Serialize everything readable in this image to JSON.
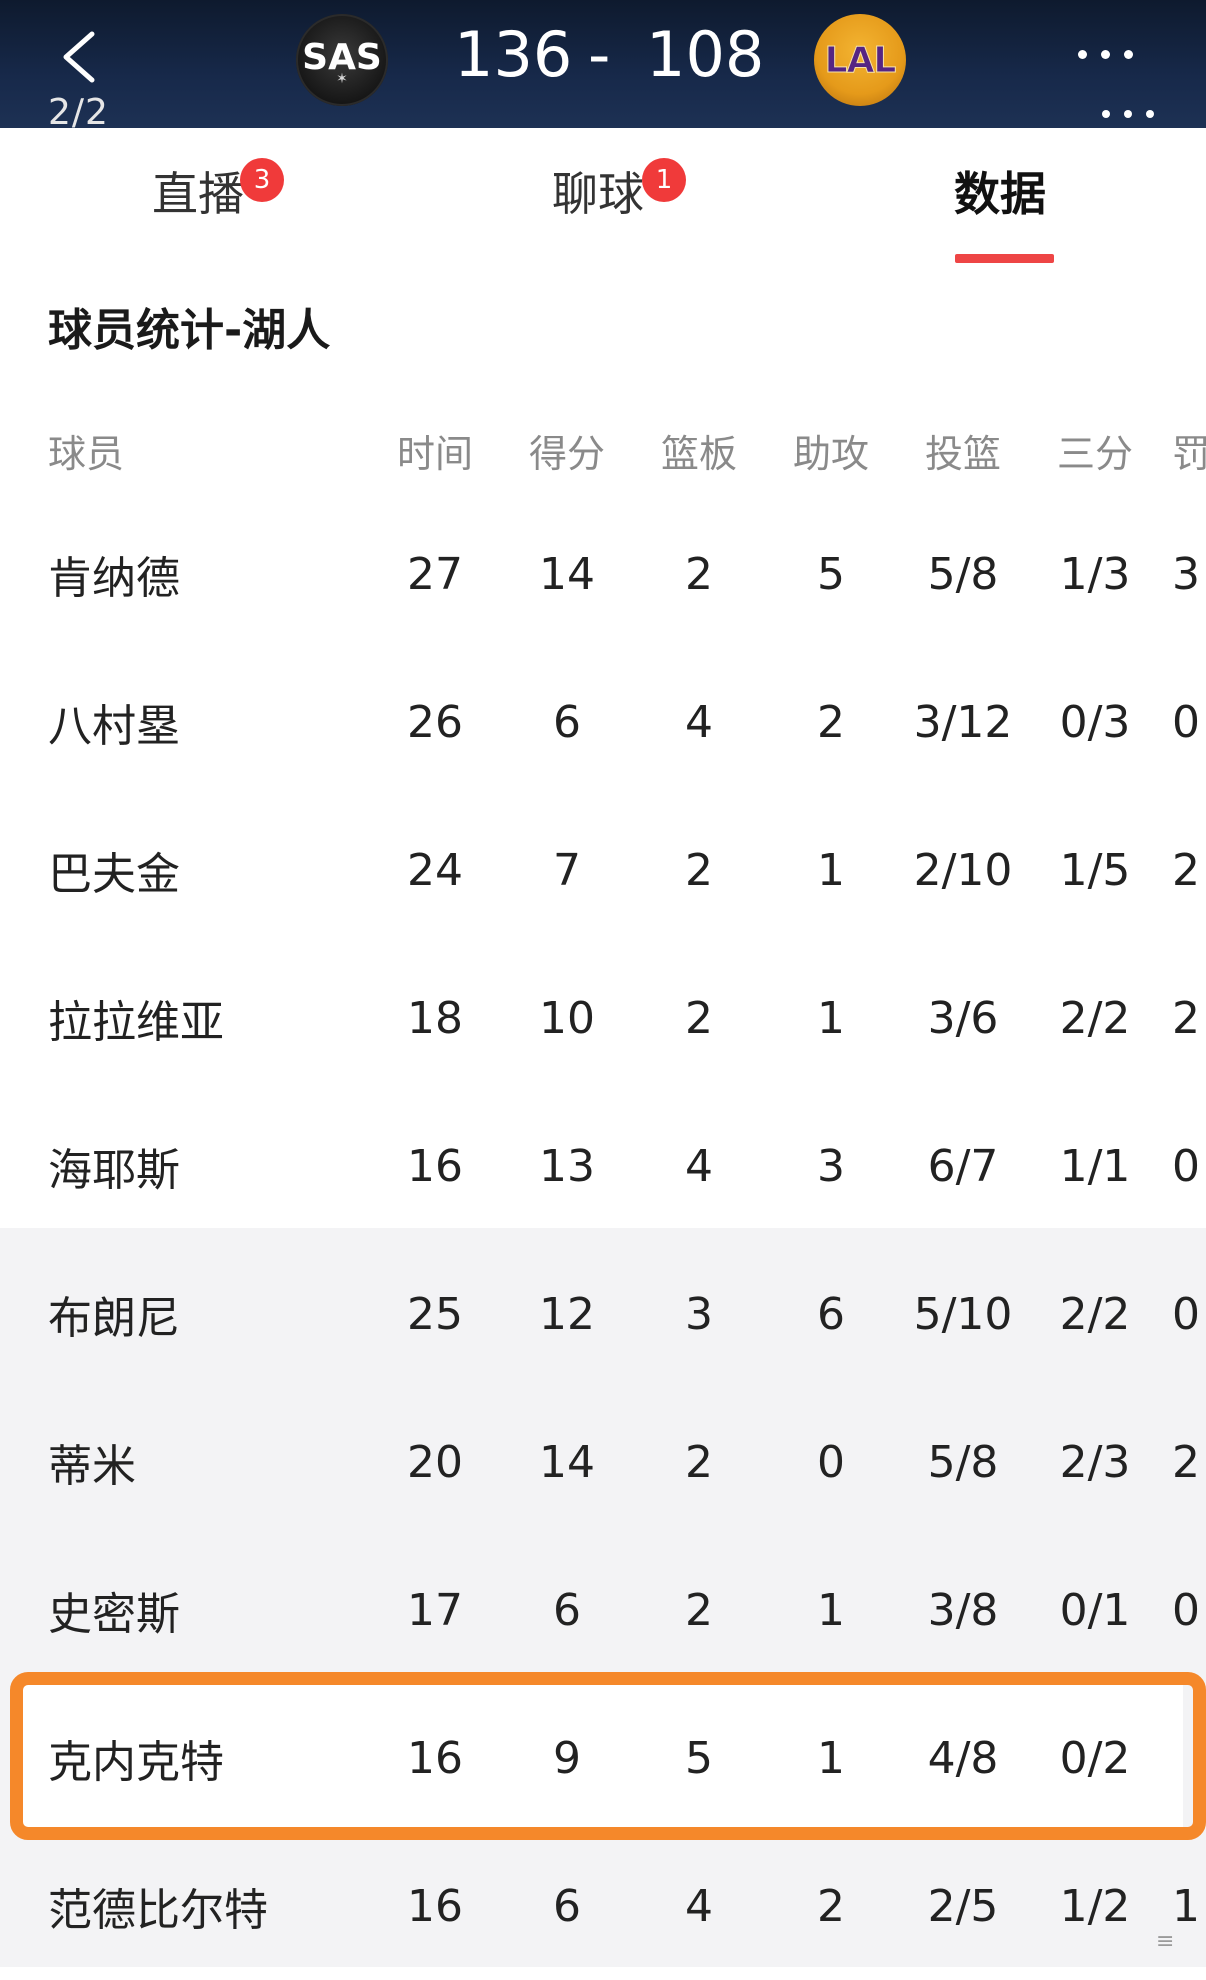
{
  "header": {
    "back_icon": "chevron-left-icon",
    "page_indicator": "2/2",
    "home_team": {
      "abbr": "SAS",
      "score": "136",
      "logo_color": "#161616"
    },
    "score_separator": "-",
    "away_team": {
      "abbr": "LAL",
      "score": "108",
      "logo_color": "#f3b432"
    },
    "more_icon": "more-dots-icon"
  },
  "tabs": [
    {
      "label": "直播",
      "badge": "3"
    },
    {
      "label": "聊球",
      "badge": "1"
    },
    {
      "label": "数据",
      "active": true
    }
  ],
  "accent_color": "#ee4545",
  "highlight_color": "#f5882a",
  "section_title": "球员统计-湖人",
  "table": {
    "columns": [
      "球员",
      "时间",
      "得分",
      "篮板",
      "助攻",
      "投篮",
      "三分",
      "罚"
    ],
    "rows": [
      {
        "name": "肯纳德",
        "cells": [
          "27",
          "14",
          "2",
          "5",
          "5/8",
          "1/3",
          "3"
        ]
      },
      {
        "name": "八村塁",
        "cells": [
          "26",
          "6",
          "4",
          "2",
          "3/12",
          "0/3",
          "0"
        ]
      },
      {
        "name": "巴夫金",
        "cells": [
          "24",
          "7",
          "2",
          "1",
          "2/10",
          "1/5",
          "2"
        ]
      },
      {
        "name": "拉拉维亚",
        "cells": [
          "18",
          "10",
          "2",
          "1",
          "3/6",
          "2/2",
          "2"
        ]
      },
      {
        "name": "海耶斯",
        "cells": [
          "16",
          "13",
          "4",
          "3",
          "6/7",
          "1/1",
          "0"
        ]
      },
      {
        "name": "布朗尼",
        "cells": [
          "25",
          "12",
          "3",
          "6",
          "5/10",
          "2/2",
          "0"
        ]
      },
      {
        "name": "蒂米",
        "cells": [
          "20",
          "14",
          "2",
          "0",
          "5/8",
          "2/3",
          "2"
        ]
      },
      {
        "name": "史密斯",
        "cells": [
          "17",
          "6",
          "2",
          "1",
          "3/8",
          "0/1",
          "0"
        ]
      },
      {
        "name": "克内克特",
        "cells": [
          "16",
          "9",
          "5",
          "1",
          "4/8",
          "0/2",
          ""
        ],
        "highlighted": true
      },
      {
        "name": "范德比尔特",
        "cells": [
          "16",
          "6",
          "4",
          "2",
          "2/5",
          "1/2",
          "1"
        ]
      }
    ]
  }
}
